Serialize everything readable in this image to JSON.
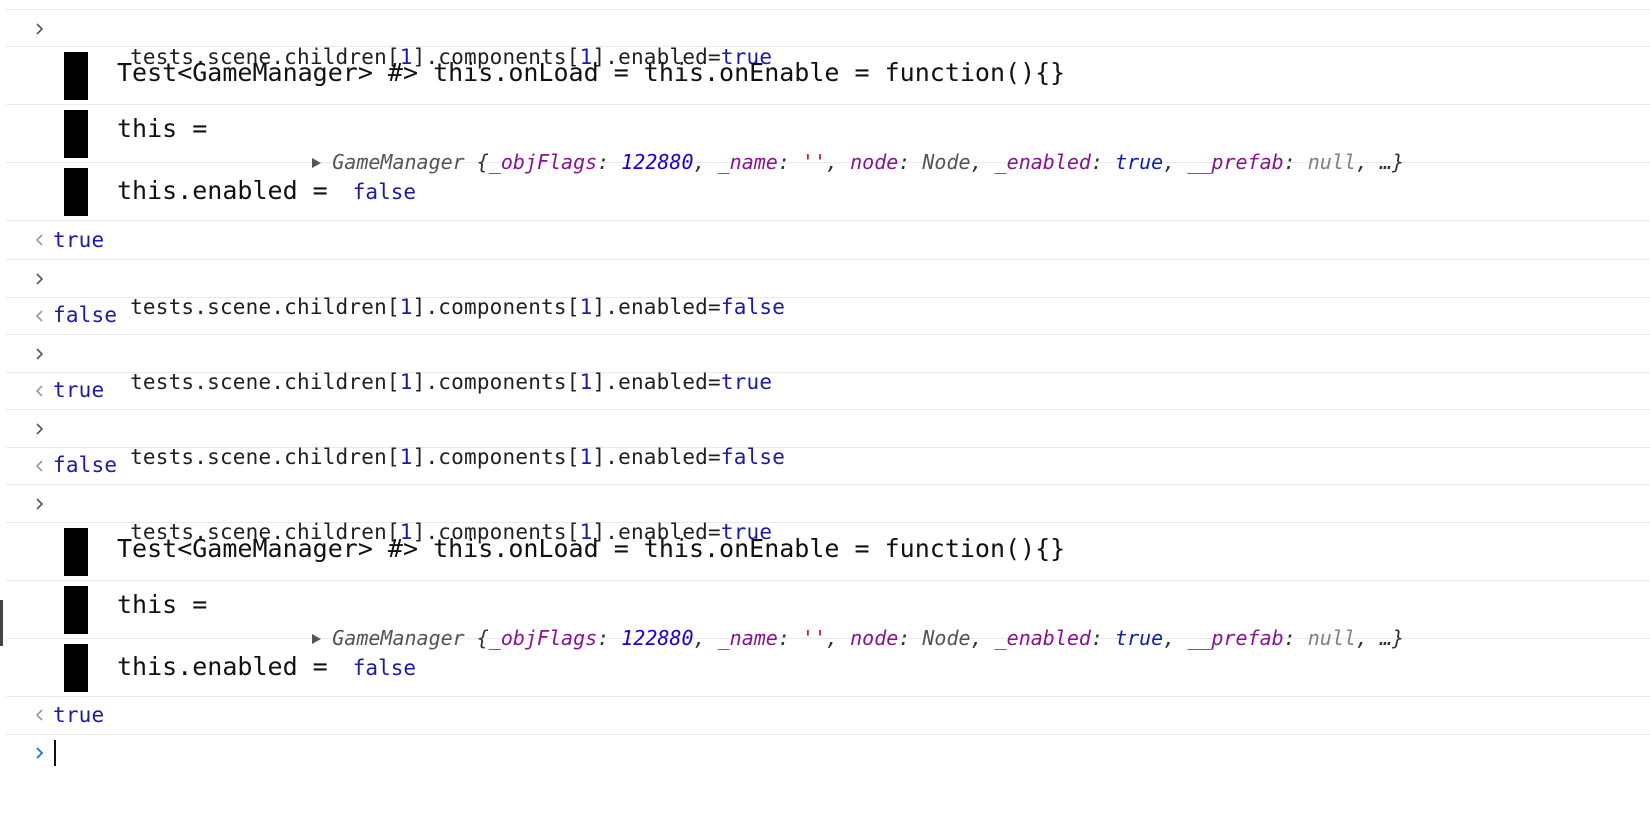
{
  "console": {
    "entries": [
      {
        "kind": "input",
        "prefix": "tests.scene.children[",
        "idx1": "1",
        "mid": "].components[",
        "idx2": "1",
        "tail": "].enabled=",
        "value": "true"
      },
      {
        "kind": "log",
        "text": "Test<GameManager> #> this.onLoad = this.onEnable = function(){}"
      },
      {
        "kind": "log-obj",
        "text": "this = "
      },
      {
        "kind": "log-bool",
        "text": "this.enabled = ",
        "value": "false"
      },
      {
        "kind": "result",
        "value": "true"
      },
      {
        "kind": "input",
        "prefix": "tests.scene.children[",
        "idx1": "1",
        "mid": "].components[",
        "idx2": "1",
        "tail": "].enabled=",
        "value": "false"
      },
      {
        "kind": "result",
        "value": "false"
      },
      {
        "kind": "input",
        "prefix": "tests.scene.children[",
        "idx1": "1",
        "mid": "].components[",
        "idx2": "1",
        "tail": "].enabled=",
        "value": "true"
      },
      {
        "kind": "result",
        "value": "true"
      },
      {
        "kind": "input",
        "prefix": "tests.scene.children[",
        "idx1": "1",
        "mid": "].components[",
        "idx2": "1",
        "tail": "].enabled=",
        "value": "false"
      },
      {
        "kind": "result",
        "value": "false"
      },
      {
        "kind": "input",
        "prefix": "tests.scene.children[",
        "idx1": "1",
        "mid": "].components[",
        "idx2": "1",
        "tail": "].enabled=",
        "value": "true"
      },
      {
        "kind": "log",
        "text": "Test<GameManager> #> this.onLoad = this.onEnable = function(){}"
      },
      {
        "kind": "log-obj",
        "text": "this = "
      },
      {
        "kind": "log-bool",
        "text": "this.enabled = ",
        "value": "false"
      },
      {
        "kind": "result",
        "value": "true"
      }
    ],
    "object_preview": {
      "class_name": "GameManager",
      "open_brace": " {",
      "k1": "_objFlags",
      "v1": "122880",
      "k2": "_name",
      "v2": "''",
      "k3": "node",
      "v3": "Node",
      "k4": "_enabled",
      "v4": "true",
      "k5": "__prefab",
      "v5": "null",
      "ellipsis": "…}"
    }
  },
  "colors": {
    "keyword_blue": "#1a1aa6",
    "property_purple": "#881391",
    "number_blue": "#1c00cf",
    "prompt_blue": "#1a73e8"
  },
  "icons": {
    "input_marker": "chevron-right-icon",
    "result_marker": "chevron-left-icon",
    "prompt_marker": "chevron-right-icon",
    "expand_marker": "triangle-right-icon"
  }
}
